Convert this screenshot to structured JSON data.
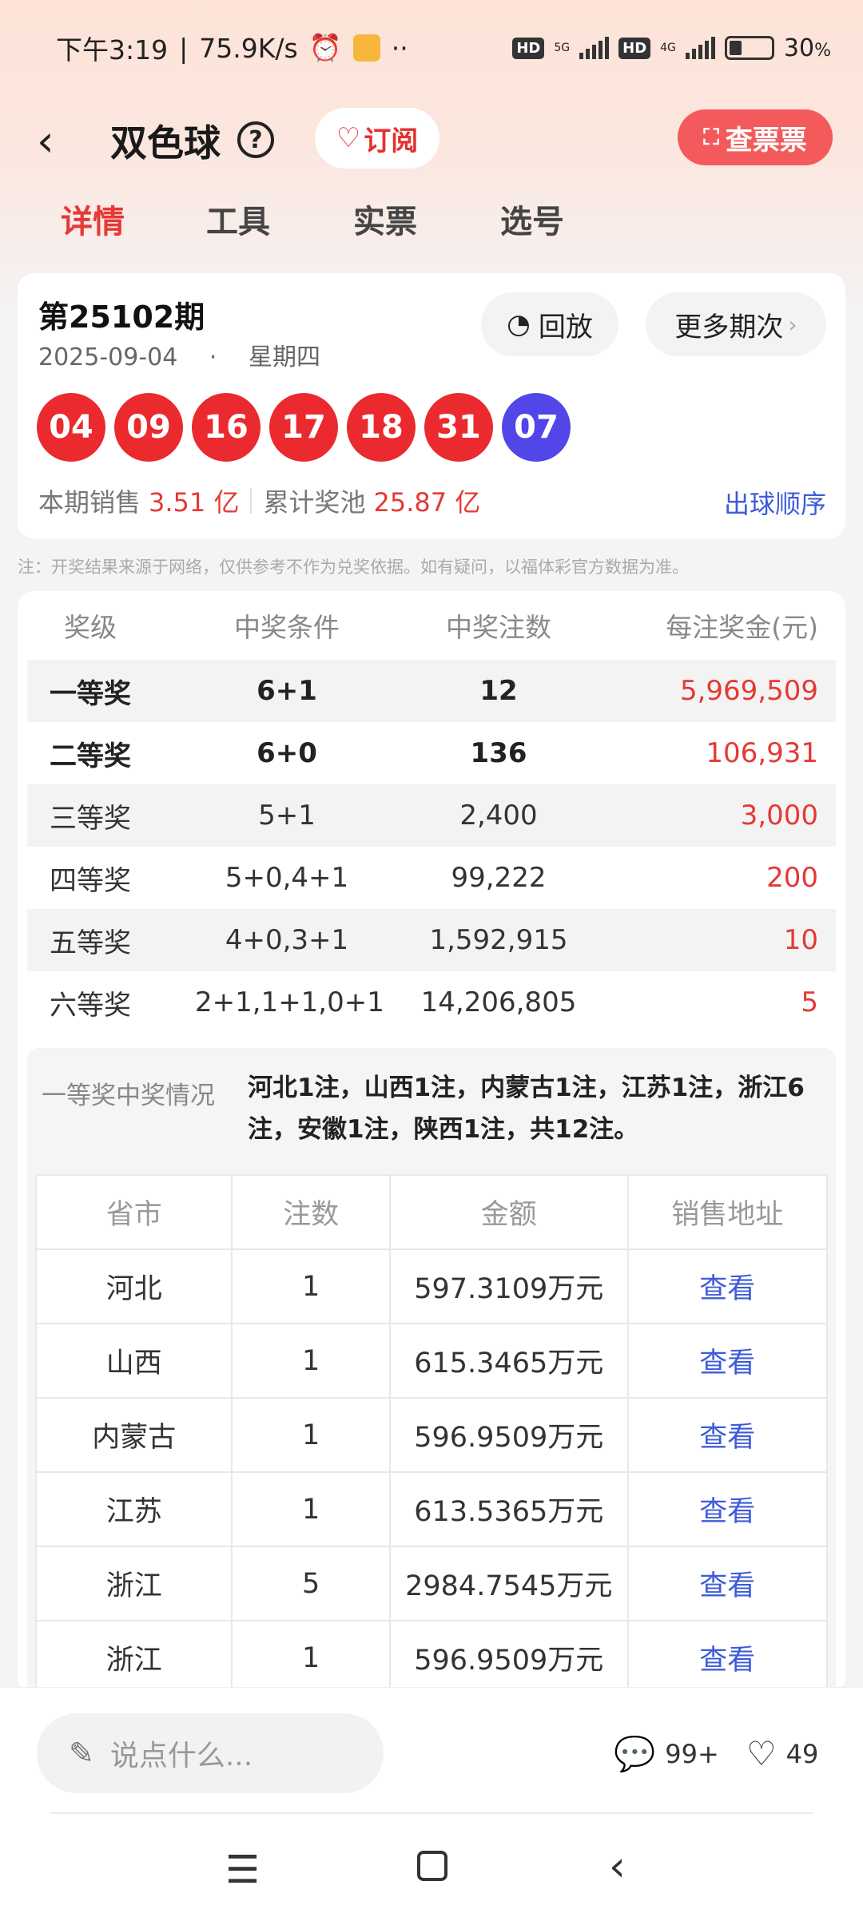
{
  "status_bar": {
    "time": "下午3:19",
    "net_speed": "75.9K/s",
    "battery_pct": "30",
    "battery_unit": "%",
    "hd1": "HD",
    "net1": "5G",
    "hd2": "HD",
    "net2": "4G"
  },
  "header": {
    "back": "‹",
    "title": "双色球",
    "help": "?",
    "subscribe": "订阅",
    "check_ticket": "查票票"
  },
  "tabs": [
    "详情",
    "工具",
    "实票",
    "选号"
  ],
  "draw": {
    "issue": "第25102期",
    "date": "2025-09-04",
    "dot": "·",
    "weekday": "星期四",
    "replay": "回放",
    "more_issues": "更多期次",
    "red_balls": [
      "04",
      "09",
      "16",
      "17",
      "18",
      "31"
    ],
    "blue_ball": "07",
    "sales_label": "本期销售",
    "sales_value": "3.51 亿",
    "pool_label": "累计奖池",
    "pool_value": "25.87 亿",
    "order_link": "出球顺序"
  },
  "note": "注：开奖结果来源于网络，仅供参考不作为兑奖依据。如有疑问，以福体彩官方数据为准。",
  "prize_table": {
    "headers": [
      "奖级",
      "中奖条件",
      "中奖注数",
      "每注奖金(元)"
    ],
    "rows": [
      [
        "一等奖",
        "6+1",
        "12",
        "5,969,509"
      ],
      [
        "二等奖",
        "6+0",
        "136",
        "106,931"
      ],
      [
        "三等奖",
        "5+1",
        "2,400",
        "3,000"
      ],
      [
        "四等奖",
        "5+0,4+1",
        "99,222",
        "200"
      ],
      [
        "五等奖",
        "4+0,3+1",
        "1,592,915",
        "10"
      ],
      [
        "六等奖",
        "2+1,1+1,0+1",
        "14,206,805",
        "5"
      ]
    ]
  },
  "winners": {
    "label": "一等奖中奖情况",
    "text": "河北1注，山西1注，内蒙古1注，江苏1注，浙江6注，安徽1注，陕西1注，共12注。",
    "headers": [
      "省市",
      "注数",
      "金额",
      "销售地址"
    ],
    "rows": [
      [
        "河北",
        "1",
        "597.3109万元",
        "查看"
      ],
      [
        "山西",
        "1",
        "615.3465万元",
        "查看"
      ],
      [
        "内蒙古",
        "1",
        "596.9509万元",
        "查看"
      ],
      [
        "江苏",
        "1",
        "613.5365万元",
        "查看"
      ],
      [
        "浙江",
        "5",
        "2984.7545万元",
        "查看"
      ],
      [
        "浙江",
        "1",
        "596.9509万元",
        "查看"
      ]
    ]
  },
  "bottom": {
    "comment_placeholder": "说点什么...",
    "comment_count": "99+",
    "like_count": "49"
  },
  "colors": {
    "accent_red": "#e53935",
    "ball_red": "#ea2a2e",
    "ball_blue": "#5147e8",
    "link_blue": "#3d5bd9"
  }
}
